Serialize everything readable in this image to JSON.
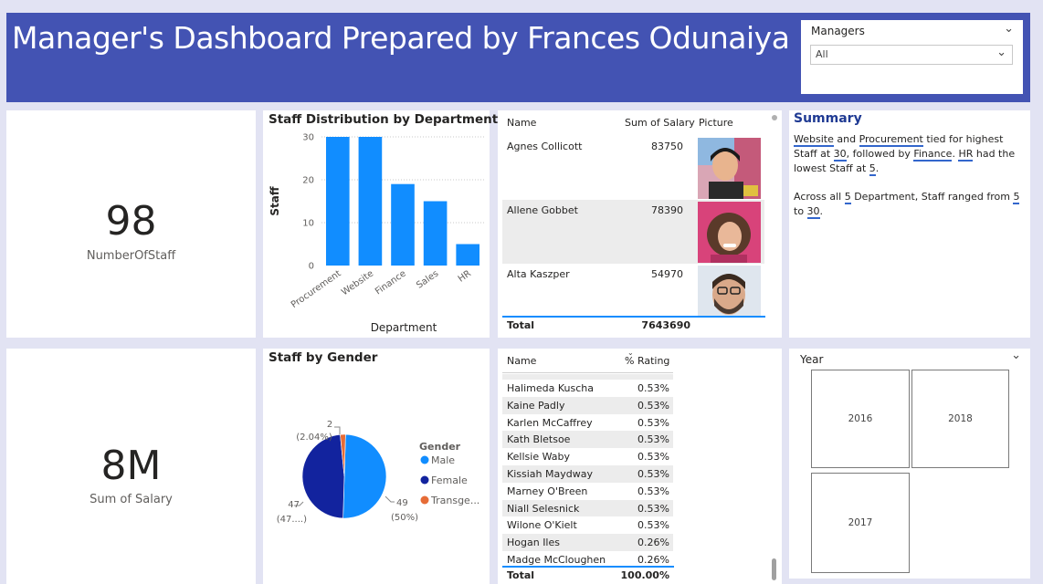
{
  "header": {
    "title": "Manager's Dashboard Prepared by Frances Odunaiya"
  },
  "managers_slicer": {
    "title": "Managers",
    "selected": "All"
  },
  "kpi_staff": {
    "value": "98",
    "label": "NumberOfStaff"
  },
  "kpi_salary": {
    "value": "8M",
    "label": "Sum of Salary"
  },
  "bar_chart": {
    "title": "Staff Distribution by Department",
    "chart_data": {
      "type": "bar",
      "title": "Staff Distribution by Department",
      "xlabel": "Department",
      "ylabel": "Staff",
      "categories": [
        "Procurement",
        "Website",
        "Finance",
        "Sales",
        "HR"
      ],
      "values": [
        30,
        30,
        19,
        15,
        5
      ],
      "ylim": [
        0,
        30
      ],
      "yticks": [
        0,
        10,
        20,
        30
      ],
      "color": "#118dff",
      "grid": true
    }
  },
  "salary_table": {
    "columns": [
      "Name",
      "Sum of Salary",
      "Picture"
    ],
    "rows": [
      {
        "name": "Agnes Collicott",
        "salary": "83750"
      },
      {
        "name": "Allene Gobbet",
        "salary": "78390"
      },
      {
        "name": "Alta Kaszper",
        "salary": "54970"
      }
    ],
    "total_label": "Total",
    "total_value": "7643690"
  },
  "summary": {
    "title": "Summary",
    "p1": [
      "Website",
      " and ",
      "Procurement",
      " tied for highest Staff at ",
      "30",
      ", followed by ",
      "Finance",
      ". ",
      "HR",
      " had the lowest Staff at ",
      "5",
      "."
    ],
    "p2": [
      "Across all ",
      "5",
      " Department, Staff ranged from ",
      "5",
      " to ",
      "30",
      "."
    ]
  },
  "pie_chart": {
    "title": "Staff by Gender",
    "legend_title": "Gender",
    "chart_data": {
      "type": "pie",
      "title": "Staff by Gender",
      "categories": [
        "Male",
        "Female",
        "Transgender"
      ],
      "values": [
        49,
        47,
        2
      ],
      "colors": [
        "#118dff",
        "#12239e",
        "#e66c37"
      ],
      "legend": [
        "Male",
        "Female",
        "Transge..."
      ],
      "data_labels": [
        {
          "value": "49",
          "pct": "(50%)"
        },
        {
          "value": "47",
          "pct": "(47....)"
        },
        {
          "value": "2",
          "pct": "(2.04%)"
        }
      ],
      "legend_position": "right"
    }
  },
  "rating_table": {
    "columns": [
      "Name",
      "% Rating"
    ],
    "rows": [
      {
        "name": "Halimeda Kuscha",
        "rating": "0.53%"
      },
      {
        "name": "Kaine Padly",
        "rating": "0.53%"
      },
      {
        "name": "Karlen McCaffrey",
        "rating": "0.53%"
      },
      {
        "name": "Kath Bletsoe",
        "rating": "0.53%"
      },
      {
        "name": "Kellsie Waby",
        "rating": "0.53%"
      },
      {
        "name": "Kissiah Maydway",
        "rating": "0.53%"
      },
      {
        "name": "Marney O'Breen",
        "rating": "0.53%"
      },
      {
        "name": "Niall Selesnick",
        "rating": "0.53%"
      },
      {
        "name": "Wilone O'Kielt",
        "rating": "0.53%"
      },
      {
        "name": "Hogan Iles",
        "rating": "0.26%"
      },
      {
        "name": "Madge McCloughen",
        "rating": "0.26%"
      }
    ],
    "total_label": "Total",
    "total_value": "100.00%"
  },
  "year_slicer": {
    "title": "Year",
    "tiles": [
      "2016",
      "2018",
      "2017"
    ]
  }
}
